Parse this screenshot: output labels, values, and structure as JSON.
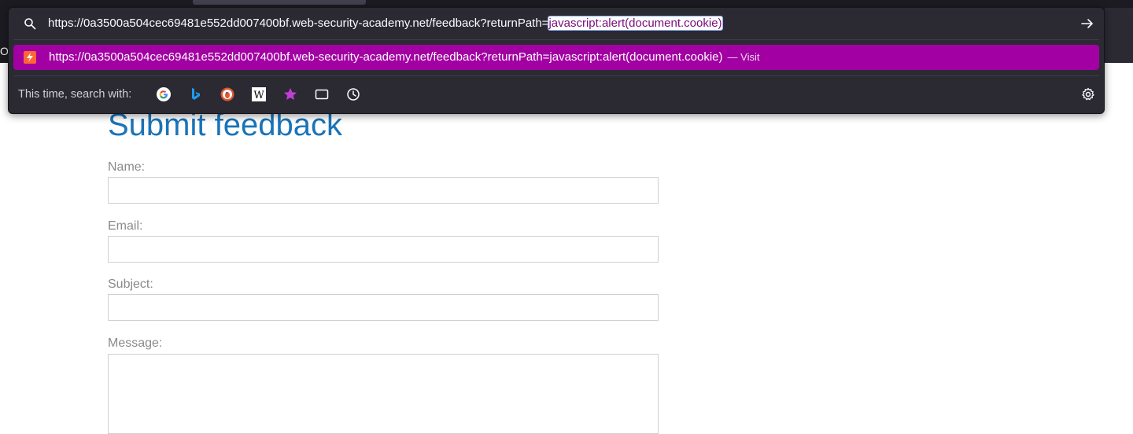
{
  "browser": {
    "url_prefix": "https://0a3500a504cec69481e552dd007400bf.web-security-academy.net/feedback?returnPath=",
    "url_selected": "javascript:alert(document.cookie)",
    "result": {
      "url": "https://0a3500a504cec69481e552dd007400bf.web-security-academy.net/feedback?returnPath=javascript:alert(document.cookie)",
      "action": "— Visit"
    },
    "engines_label": "This time, search with:",
    "left_fragment": "Oc",
    "icons": {
      "search": "search-icon",
      "go": "arrow-right-icon",
      "site": "site-favicon-icon",
      "engines": [
        "google-icon",
        "bing-icon",
        "duckduckgo-icon",
        "wikipedia-icon",
        "bookmarks-star-icon",
        "tabs-icon",
        "history-icon"
      ],
      "settings": "gear-icon"
    },
    "colors": {
      "accent": "#a200a2",
      "title": "#1a74b8"
    }
  },
  "page": {
    "title": "Submit feedback",
    "fields": [
      {
        "label": "Name:"
      },
      {
        "label": "Email:"
      },
      {
        "label": "Subject:"
      },
      {
        "label": "Message:"
      }
    ]
  }
}
